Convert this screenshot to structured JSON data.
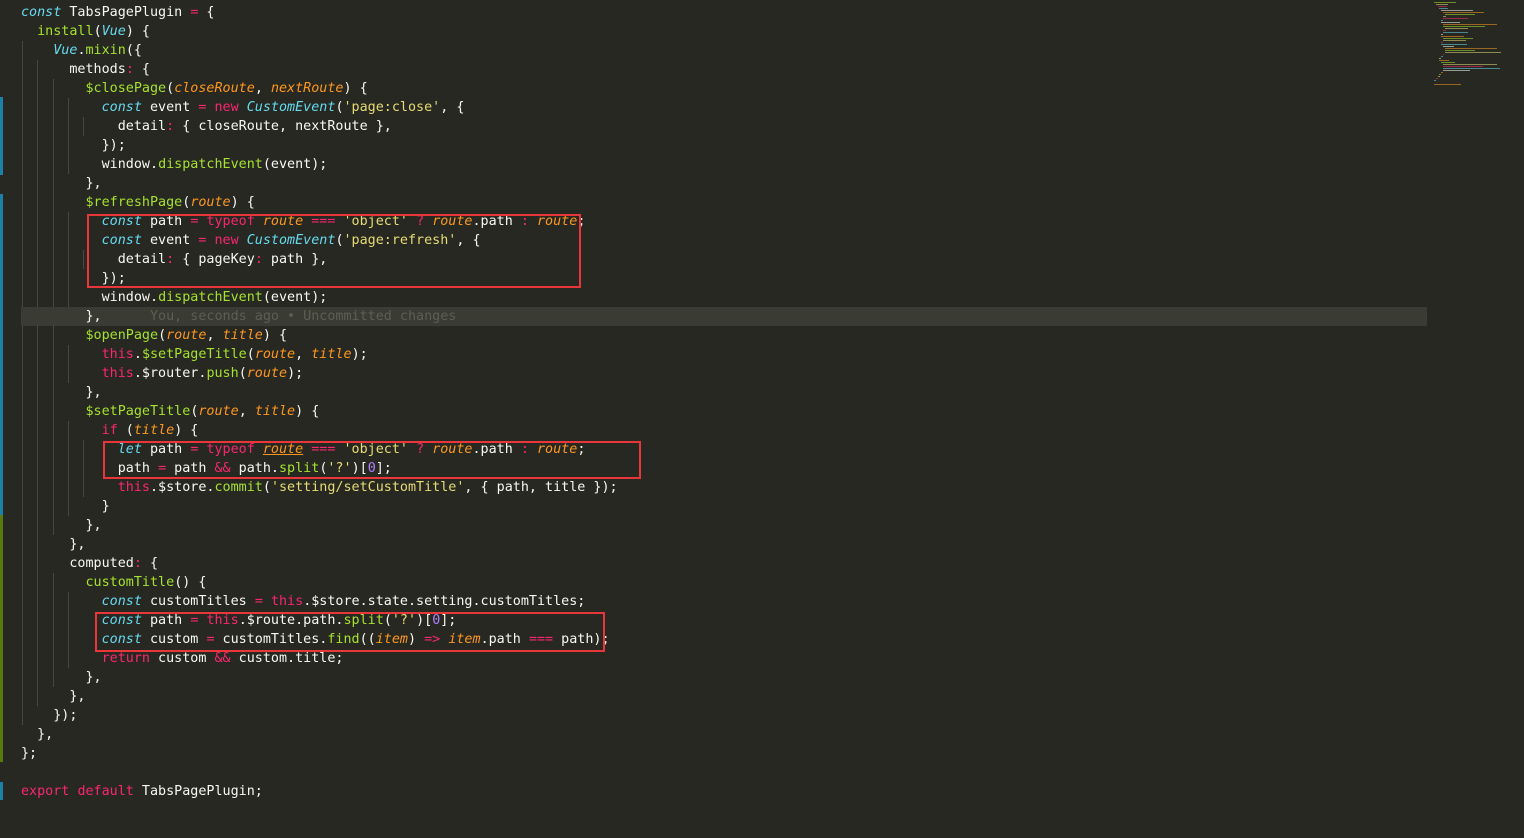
{
  "editor": {
    "language": "javascript",
    "theme": "monokai-like",
    "blame_annotation": "You, seconds ago • Uncommitted changes",
    "lines": [
      "const TabsPagePlugin = {",
      "  install(Vue) {",
      "    Vue.mixin({",
      "      methods: {",
      "        $closePage(closeRoute, nextRoute) {",
      "          const event = new CustomEvent('page:close', {",
      "            detail: { closeRoute, nextRoute },",
      "          });",
      "          window.dispatchEvent(event);",
      "        },",
      "        $refreshPage(route) {",
      "          const path = typeof route === 'object' ? route.path : route;",
      "          const event = new CustomEvent('page:refresh', {",
      "            detail: { pageKey: path },",
      "          });",
      "          window.dispatchEvent(event);",
      "        },",
      "        $openPage(route, title) {",
      "          this.$setPageTitle(route, title);",
      "          this.$router.push(route);",
      "        },",
      "        $setPageTitle(route, title) {",
      "          if (title) {",
      "            let path = typeof route === 'object' ? route.path : route;",
      "            path = path && path.split('?')[0];",
      "            this.$store.commit('setting/setCustomTitle', { path, title });",
      "          }",
      "        },",
      "      },",
      "      computed: {",
      "        customTitle() {",
      "          const customTitles = this.$store.state.setting.customTitles;",
      "          const path = this.$route.path.split('?')[0];",
      "          const custom = customTitles.find((item) => item.path === path);",
      "          return custom && custom.title;",
      "        },",
      "      },",
      "    });",
      "  },",
      "};",
      "",
      "export default TabsPagePlugin;"
    ]
  },
  "annotations": {
    "highlight_color": "#e8363b",
    "boxes": [
      "refreshPage-body",
      "setPageTitle-path",
      "customTitle-path"
    ]
  }
}
